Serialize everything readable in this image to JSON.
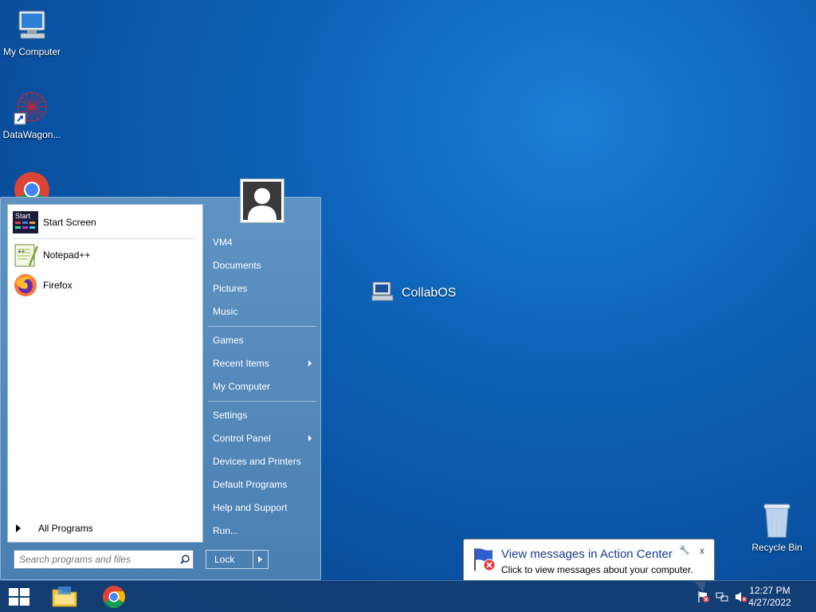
{
  "desktop": {
    "icons": [
      {
        "label": "My Computer"
      },
      {
        "label": "DataWagon..."
      },
      {
        "label": "CollabOS"
      },
      {
        "label": "Recycle Bin"
      }
    ]
  },
  "start_menu": {
    "programs": [
      {
        "label": "Start Screen",
        "icon": "start-screen-icon"
      },
      {
        "label": "Notepad++",
        "icon": "notepad-plus-plus-icon"
      },
      {
        "label": "Firefox",
        "icon": "firefox-icon"
      }
    ],
    "all_programs": "All Programs",
    "search_placeholder": "Search programs and files",
    "right_items": [
      {
        "label": "VM4"
      },
      {
        "label": "Documents"
      },
      {
        "label": "Pictures"
      },
      {
        "label": "Music"
      },
      {
        "label": "Games"
      },
      {
        "label": "Recent Items",
        "submenu": true
      },
      {
        "label": "My Computer"
      },
      {
        "label": "Settings"
      },
      {
        "label": "Control Panel",
        "submenu": true
      },
      {
        "label": "Devices and Printers"
      },
      {
        "label": "Default Programs"
      },
      {
        "label": "Help and Support"
      },
      {
        "label": "Run..."
      }
    ],
    "lock_label": "Lock"
  },
  "taskbar": {
    "pinned": [
      "start-button",
      "file-explorer-icon",
      "chrome-icon"
    ],
    "clock_time": "12:27 PM",
    "clock_date": "4/27/2022"
  },
  "balloon": {
    "title": "View messages in Action Center",
    "message": "Click to view messages about your computer.",
    "close": "x"
  }
}
